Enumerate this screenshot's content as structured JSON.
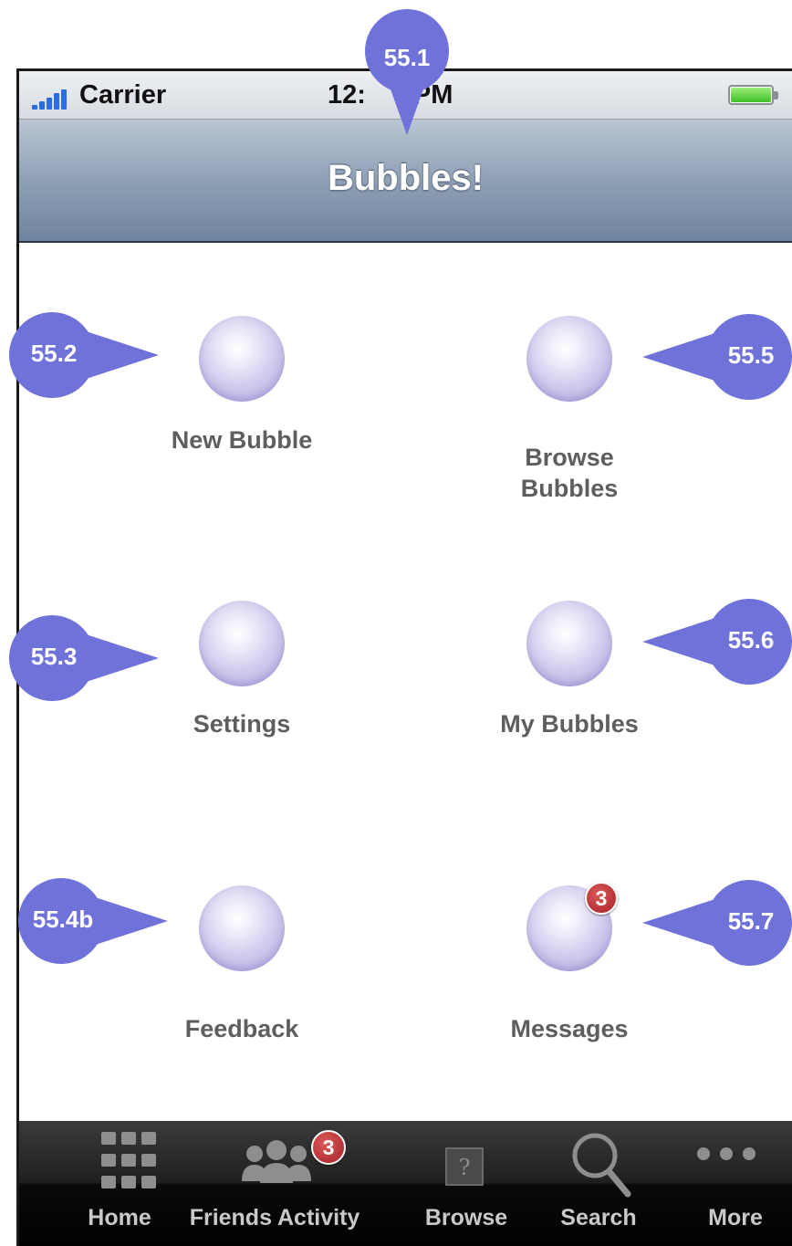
{
  "status_bar": {
    "carrier": "Carrier",
    "time": "12:",
    "time_suffix": "PM"
  },
  "nav": {
    "title": "Bubbles!"
  },
  "menu": [
    {
      "id": "new",
      "label": "New Bubble"
    },
    {
      "id": "browse",
      "label_line1": "Browse",
      "label_line2": "Bubbles"
    },
    {
      "id": "settings",
      "label": "Settings"
    },
    {
      "id": "my",
      "label": "My Bubbles"
    },
    {
      "id": "feedback",
      "label": "Feedback"
    },
    {
      "id": "messages",
      "label": "Messages",
      "badge": "3"
    }
  ],
  "tabs": [
    {
      "label": "Home",
      "icon": "grid-icon"
    },
    {
      "label": "Friends Activity",
      "icon": "people-icon",
      "badge": "3"
    },
    {
      "label": "Browse",
      "icon": "question-box-icon"
    },
    {
      "label": "Search",
      "icon": "search-icon"
    },
    {
      "label": "More",
      "icon": "more-dots-icon"
    }
  ],
  "annotations": [
    "55.1",
    "55.2",
    "55.3",
    "55.4b",
    "55.5",
    "55.6",
    "55.7"
  ],
  "colors": {
    "annotation": "#6f72d8",
    "badge": "#a81f26",
    "nav_bar": "#8c9db3",
    "tab_bar": "#000000"
  }
}
